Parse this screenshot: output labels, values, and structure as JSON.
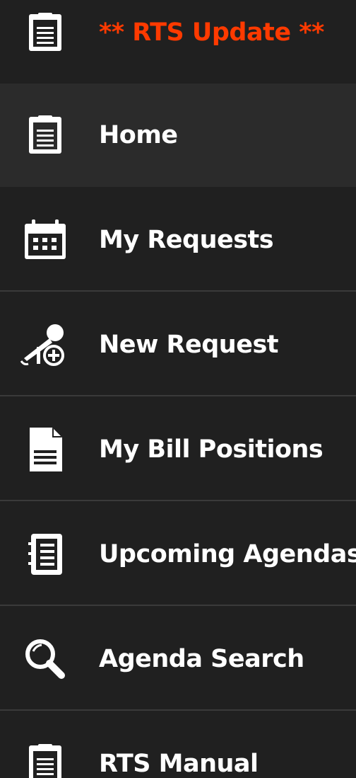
{
  "sidebar": {
    "items": [
      {
        "label": "** RTS Update **",
        "icon": "clipboard-icon",
        "alert": true
      },
      {
        "label": "Home",
        "icon": "clipboard-icon",
        "active": true
      },
      {
        "label": "My Requests",
        "icon": "calendar-icon"
      },
      {
        "label": "New Request",
        "icon": "microphone-add-icon"
      },
      {
        "label": "My Bill Positions",
        "icon": "document-icon"
      },
      {
        "label": "Upcoming Agendas",
        "icon": "notepad-icon"
      },
      {
        "label": "Agenda Search",
        "icon": "search-icon"
      },
      {
        "label": "RTS Manual",
        "icon": "clipboard-icon"
      }
    ]
  },
  "colors": {
    "background": "#202020",
    "active_background": "#2b2b2b",
    "alert_text": "#ff3a00",
    "text": "#ffffff",
    "divider": "#3a3a3a"
  }
}
